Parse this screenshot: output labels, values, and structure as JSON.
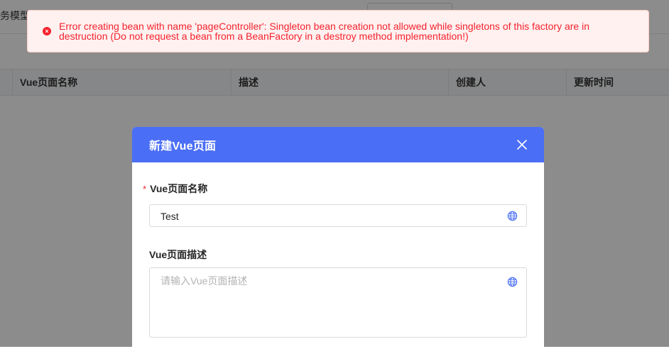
{
  "background": {
    "tab_partial_label": "务模型",
    "table_columns": [
      "Vue页面名称",
      "描述",
      "创建人",
      "更新时间"
    ]
  },
  "alert": {
    "icon": "error-circle-icon",
    "message": "Error creating bean with name 'pageController': Singleton bean creation not allowed while singletons of this factory are in destruction (Do not request a bean from a BeanFactory in a destroy method implementation!)",
    "color": "#f5222d"
  },
  "modal": {
    "title": "新建Vue页面",
    "header_color": "#4a6ef5",
    "close_icon": "close-icon",
    "fields": {
      "name_label": "Vue页面名称",
      "name_required_mark": "*",
      "name_value": "Test",
      "desc_label": "Vue页面描述",
      "desc_placeholder": "请输入Vue页面描述"
    }
  }
}
